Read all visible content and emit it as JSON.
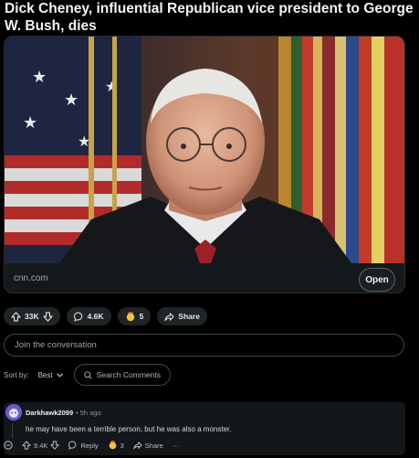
{
  "post": {
    "title": "Dick Cheney, influential Republican vice president to George W. Bush, dies",
    "domain": "cnn.com",
    "open_label": "Open"
  },
  "actions": {
    "upvotes": "33K",
    "comments": "4.6K",
    "awards": "5",
    "share_label": "Share"
  },
  "join": {
    "placeholder": "Join the conversation"
  },
  "sort": {
    "label": "Sort by:",
    "value": "Best",
    "search_placeholder": "Search Comments"
  },
  "comment": {
    "author": "Darkhawk2099",
    "time": "• 5h ago",
    "text": "he may have been a terrible person, but he was also a monster.",
    "upvotes": "9.4K",
    "reply_label": "Reply",
    "awards": "3",
    "share_label": "Share",
    "more_label": "···"
  },
  "colors": {
    "background": "#000000",
    "pill": "#1f2427",
    "avatar": "#6b5bd2",
    "award": "#f5c33b"
  }
}
